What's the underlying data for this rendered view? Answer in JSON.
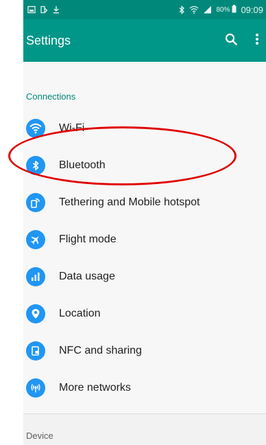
{
  "status_bar": {
    "battery": "80%",
    "time": "09:09",
    "icons": [
      "image-icon",
      "screen-icon",
      "download-icon",
      "bluetooth-icon",
      "wifi-icon",
      "signal-icon",
      "battery-icon"
    ]
  },
  "app_bar": {
    "title": "Settings",
    "icons": [
      "search-icon",
      "more-vert-icon"
    ]
  },
  "sections": {
    "connections": "Connections",
    "device": "Device"
  },
  "items": [
    {
      "label": "Wi-Fi",
      "icon": "wifi-icon"
    },
    {
      "label": "Bluetooth",
      "icon": "bluetooth-icon"
    },
    {
      "label": "Tethering and Mobile hotspot",
      "icon": "hotspot-icon"
    },
    {
      "label": "Flight mode",
      "icon": "airplane-icon"
    },
    {
      "label": "Data usage",
      "icon": "data-usage-icon"
    },
    {
      "label": "Location",
      "icon": "location-icon"
    },
    {
      "label": "NFC and sharing",
      "icon": "nfc-icon"
    },
    {
      "label": "More networks",
      "icon": "antenna-icon"
    }
  ],
  "colors": {
    "status_bar": "#00897b",
    "app_bar": "#009688",
    "icon_bg": "#2196f3",
    "section_header": "#00897b",
    "highlight": "#e00000"
  }
}
